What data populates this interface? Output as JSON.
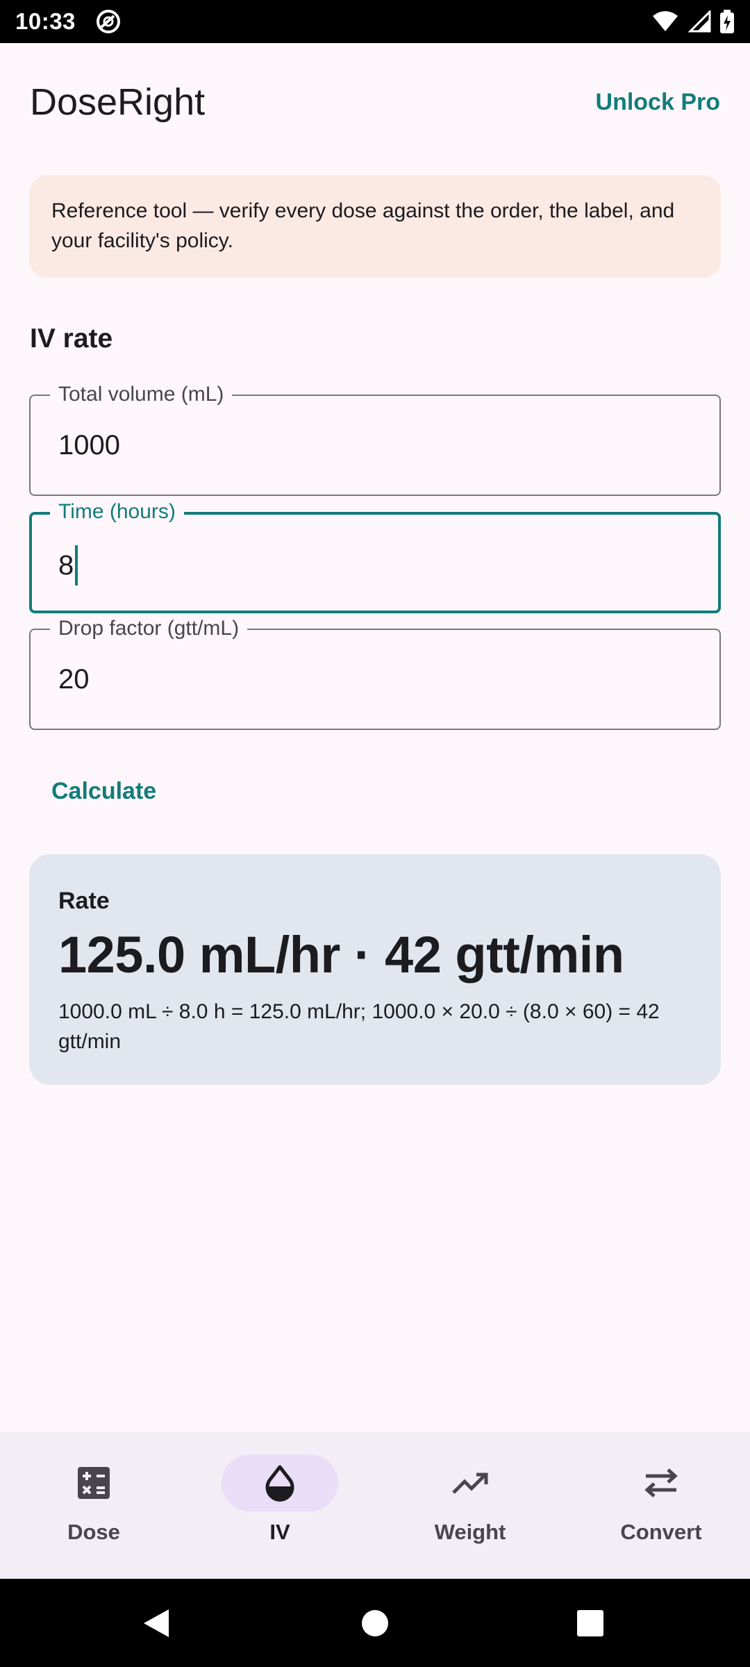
{
  "status_bar": {
    "time": "10:33"
  },
  "header": {
    "app_title": "DoseRight",
    "unlock_label": "Unlock Pro"
  },
  "disclaimer": {
    "text": "Reference tool — verify every dose against the order, the label, and your facility's policy."
  },
  "section": {
    "title": "IV rate"
  },
  "fields": {
    "volume": {
      "label": "Total volume (mL)",
      "value": "1000"
    },
    "time": {
      "label": "Time (hours)",
      "value": "8"
    },
    "drop_factor": {
      "label": "Drop factor (gtt/mL)",
      "value": "20"
    }
  },
  "calculate_label": "Calculate",
  "result": {
    "label": "Rate",
    "value": "125.0 mL/hr · 42 gtt/min",
    "formula": "1000.0 mL ÷ 8.0 h = 125.0 mL/hr; 1000.0 × 20.0 ÷ (8.0 × 60) = 42 gtt/min"
  },
  "nav": {
    "items": [
      {
        "label": "Dose",
        "icon": "calculator-icon"
      },
      {
        "label": "IV",
        "icon": "drop-icon",
        "active": true
      },
      {
        "label": "Weight",
        "icon": "trending-up-icon"
      },
      {
        "label": "Convert",
        "icon": "swap-icon"
      }
    ]
  },
  "colors": {
    "accent": "#127c7a",
    "disclaimer_bg": "#fbe9e3",
    "result_bg": "#e2e6ee",
    "nav_bg": "#f3edf6",
    "nav_active": "#e8def8"
  }
}
